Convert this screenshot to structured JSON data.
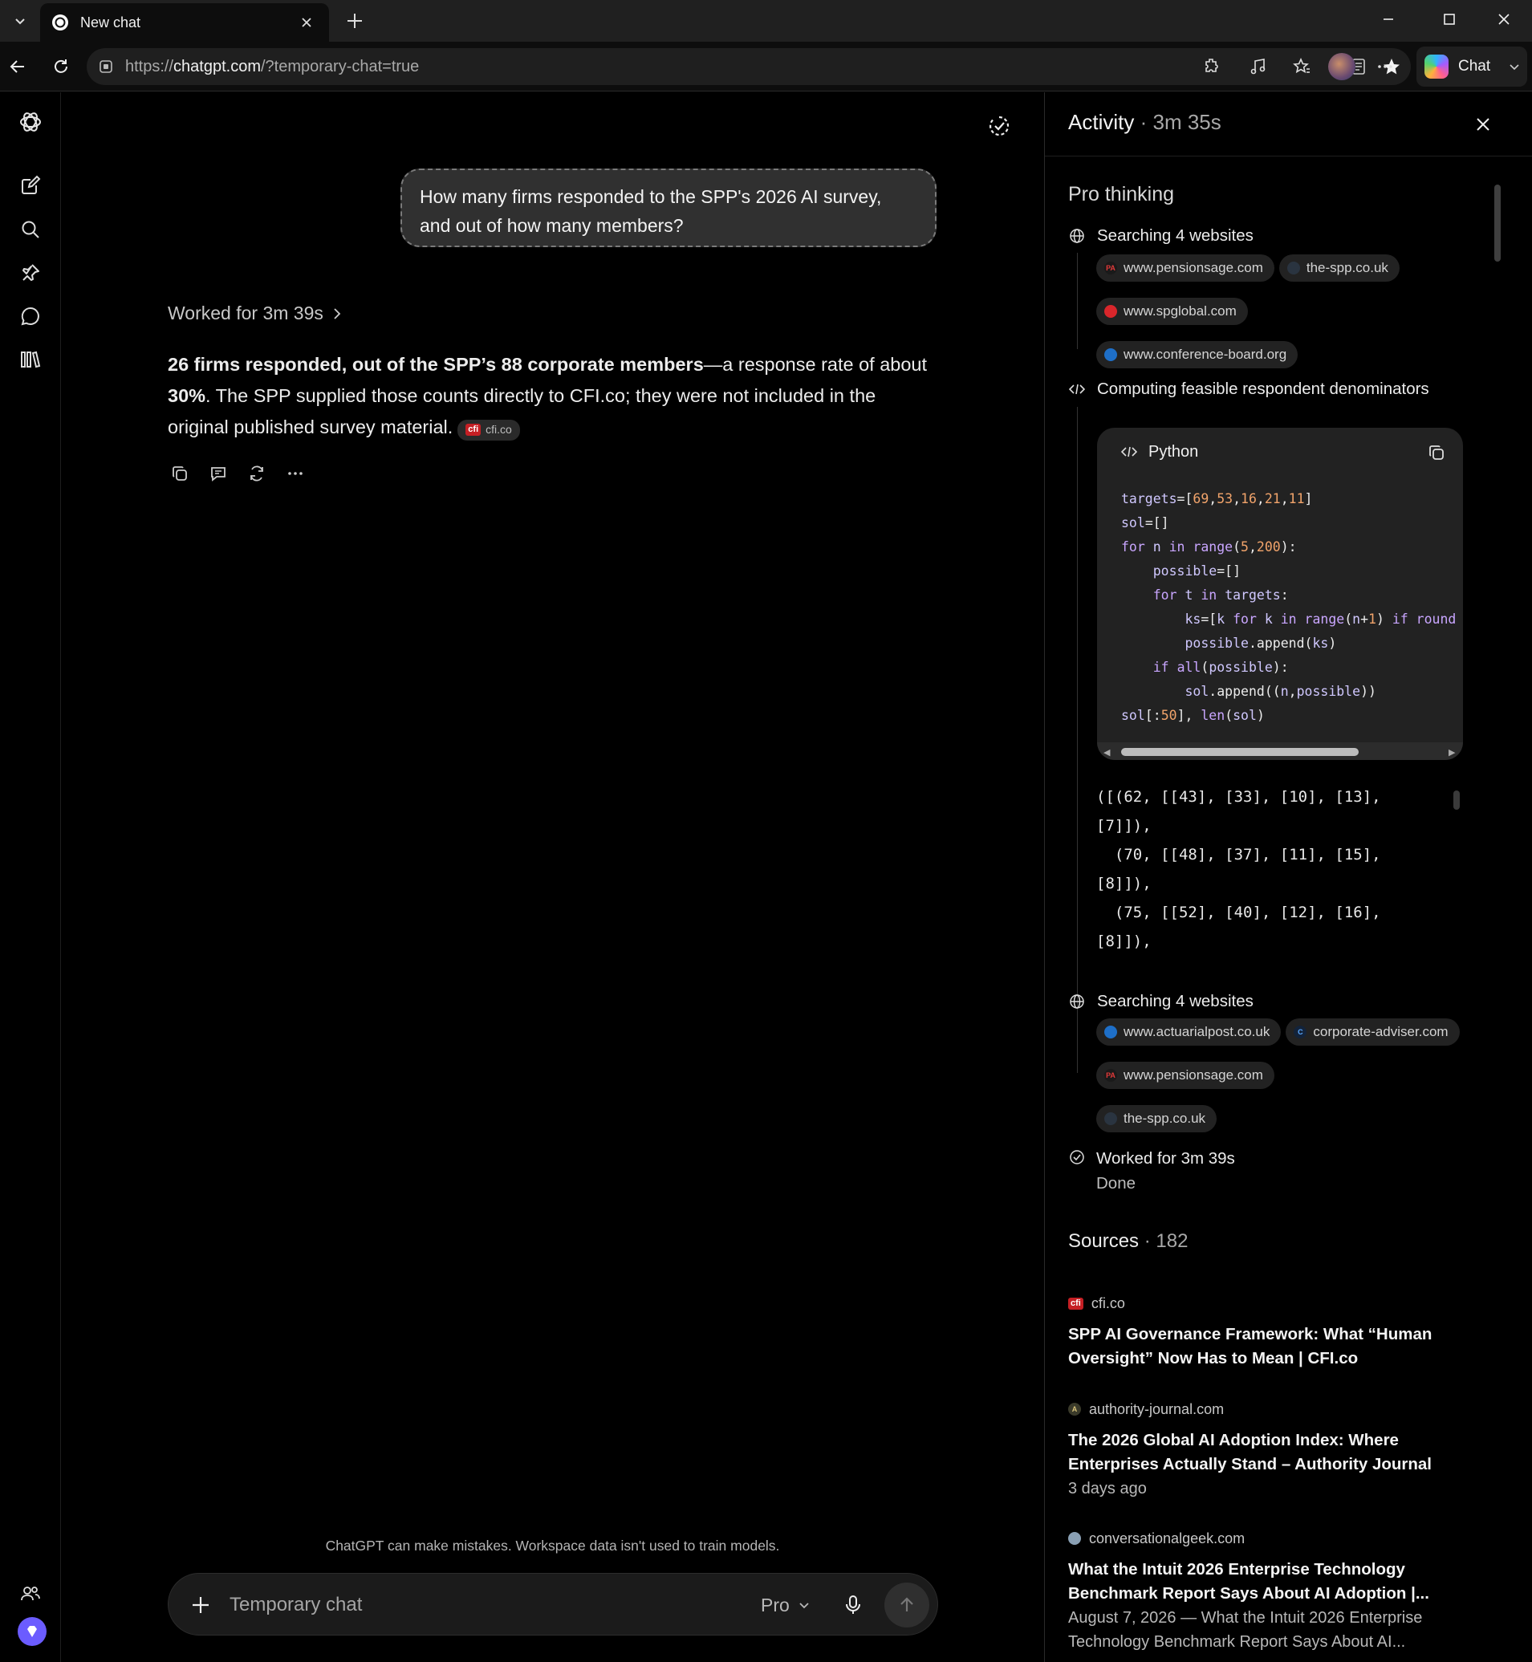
{
  "browser": {
    "tab_title": "New chat",
    "url_prefix": "https://",
    "url_host": "chatgpt.com",
    "url_path": "/?temporary-chat=true",
    "copilot_label": "Chat"
  },
  "chat": {
    "user_message": "How many firms responded to the SPP's 2026 AI survey, and out of how many members?",
    "worked_label": "Worked for 3m 39s",
    "answer_bold": "26 firms responded, out of the SPP’s 88 corporate members",
    "answer_part2": "—a response rate of about ",
    "answer_bold2": "30%",
    "answer_part3": ". The SPP supplied those counts directly to CFI.co; they were not included in the original published survey material.",
    "citation_label": "cfi.co",
    "citation_logo": "cfi",
    "disclaimer": "ChatGPT can make mistakes. Workspace data isn't used to train models.",
    "composer_placeholder": "Temporary chat",
    "model_label": "Pro"
  },
  "activity": {
    "title": "Activity",
    "separator": "·",
    "duration": "3m 35s",
    "section_title": "Pro thinking",
    "step1": {
      "label": "Searching 4 websites",
      "sites": [
        {
          "name": "www.pensionsage.com",
          "icon": "PA",
          "color": "#1a1a1a",
          "fg": "#e23a3a"
        },
        {
          "name": "the-spp.co.uk",
          "icon": "",
          "color": "#2a3440",
          "fg": "#fff"
        },
        {
          "name": "www.spglobal.com",
          "icon": "",
          "color": "#d9262b",
          "fg": "#fff"
        },
        {
          "name": "www.conference-board.org",
          "icon": "",
          "color": "#1e6fc8",
          "fg": "#fff"
        }
      ]
    },
    "step2": {
      "label": "Computing feasible respondent denominators",
      "code_lang": "Python",
      "output": "([(62, [[43], [33], [10], [13],\n[7]]),\n  (70, [[48], [37], [11], [15],\n[8]]),\n  (75, [[52], [40], [12], [16],\n[8]]),"
    },
    "step3": {
      "label": "Searching 4 websites",
      "sites": [
        {
          "name": "www.actuarialpost.co.uk",
          "icon": "",
          "color": "#1e6fc8",
          "fg": "#fff"
        },
        {
          "name": "corporate-adviser.com",
          "icon": "C",
          "color": "#13233a",
          "fg": "#5aa8ff"
        },
        {
          "name": "www.pensionsage.com",
          "icon": "PA",
          "color": "#1a1a1a",
          "fg": "#e23a3a"
        },
        {
          "name": "the-spp.co.uk",
          "icon": "",
          "color": "#2a3440",
          "fg": "#fff"
        }
      ]
    },
    "worked": "Worked for 3m 39s",
    "done": "Done",
    "sources_label": "Sources",
    "sources_count": "182",
    "sources": [
      {
        "site": "cfi.co",
        "title": "SPP AI Governance Framework: What “Human Oversight” Now Has to Mean | CFI.co",
        "meta": ""
      },
      {
        "site": "authority-journal.com",
        "title": "The 2026 Global AI Adoption Index: Where Enterprises Actually Stand – Authority Journal",
        "meta": "3 days ago"
      },
      {
        "site": "conversationalgeek.com",
        "title": "What the Intuit 2026 Enterprise Technology Benchmark Report Says About AI Adoption |...",
        "meta": "August 7, 2026 — What the Intuit 2026 Enterprise Technology Benchmark Report Says About AI..."
      }
    ]
  }
}
